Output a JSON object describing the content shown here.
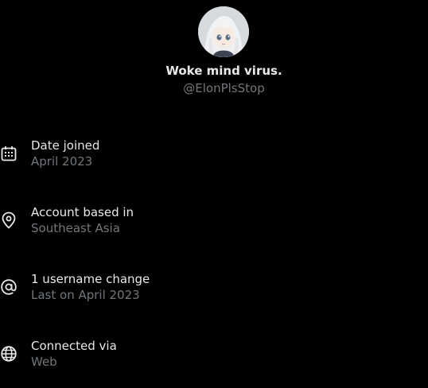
{
  "profile": {
    "display_name": "Woke mind virus.",
    "handle": "@ElonPlsStop",
    "avatar": "anime-character-avatar"
  },
  "about": [
    {
      "icon": "calendar-icon",
      "label": "Date joined",
      "value": "April 2023"
    },
    {
      "icon": "location-pin-icon",
      "label": "Account based in",
      "value": "Southeast Asia"
    },
    {
      "icon": "at-sign-icon",
      "label": "1 username change",
      "value": "Last on April 2023"
    },
    {
      "icon": "globe-icon",
      "label": "Connected via",
      "value": "Web"
    }
  ],
  "colors": {
    "background": "#000000",
    "primary_text": "#e7e9ea",
    "secondary_text": "#71767b"
  }
}
